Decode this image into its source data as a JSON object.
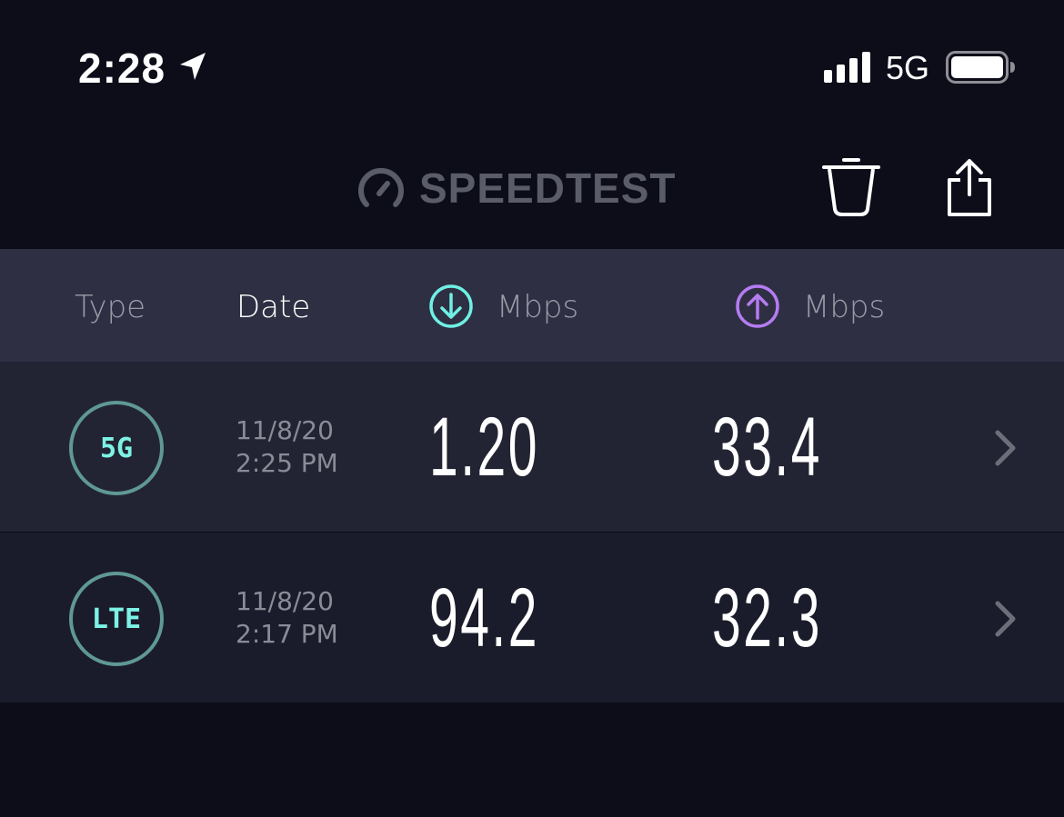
{
  "status_bar": {
    "time": "2:28",
    "network": "5G"
  },
  "header": {
    "brand": "SPEEDTEST"
  },
  "columns": {
    "type": "Type",
    "date": "Date",
    "download_unit": "Mbps",
    "upload_unit": "Mbps"
  },
  "colors": {
    "background": "#0c0d19",
    "download_accent": "#6ff0e4",
    "upload_accent": "#b57cf2",
    "badge_text": "#7df2e6"
  },
  "results": [
    {
      "type": "5G",
      "date": "11/8/20",
      "time": "2:25 PM",
      "download": "1.20",
      "upload": "33.4"
    },
    {
      "type": "LTE",
      "date": "11/8/20",
      "time": "2:17 PM",
      "download": "94.2",
      "upload": "32.3"
    }
  ]
}
